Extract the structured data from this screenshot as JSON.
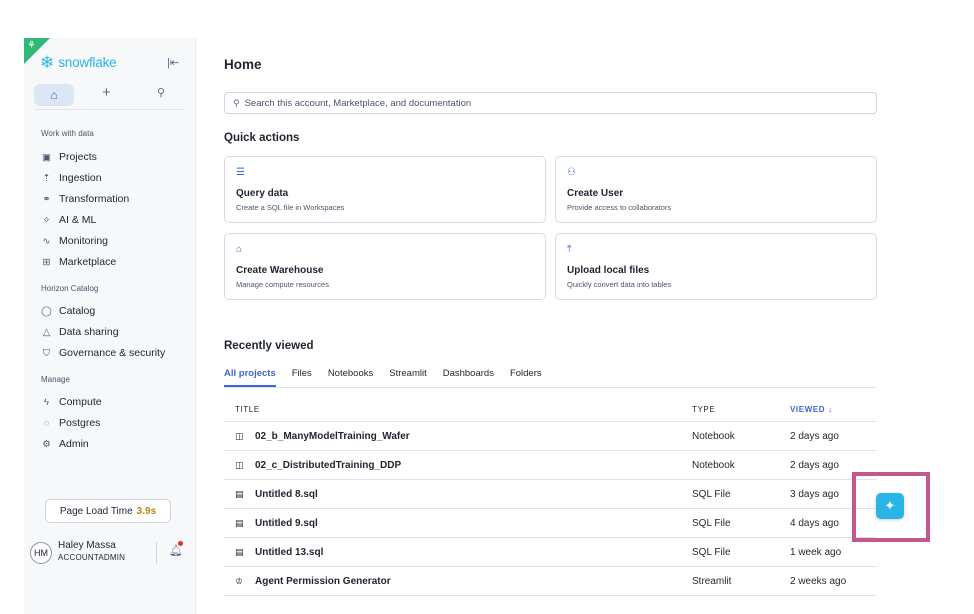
{
  "sidebar": {
    "brand": "snowflake",
    "sections": {
      "work_with_data": "Work with data",
      "horizon_catalog": "Horizon Catalog",
      "manage": "Manage"
    },
    "items": [
      {
        "label": "Projects",
        "icon": "projects-icon"
      },
      {
        "label": "Ingestion",
        "icon": "ingestion-icon"
      },
      {
        "label": "Transformation",
        "icon": "transformation-icon"
      },
      {
        "label": "AI & ML",
        "icon": "ai-ml-icon"
      },
      {
        "label": "Monitoring",
        "icon": "monitoring-icon"
      },
      {
        "label": "Marketplace",
        "icon": "marketplace-icon"
      },
      {
        "label": "Catalog",
        "icon": "catalog-icon"
      },
      {
        "label": "Data sharing",
        "icon": "data-sharing-icon"
      },
      {
        "label": "Governance & security",
        "icon": "shield-icon"
      },
      {
        "label": "Compute",
        "icon": "compute-icon"
      },
      {
        "label": "Postgres",
        "icon": "postgres-icon"
      },
      {
        "label": "Admin",
        "icon": "admin-icon"
      }
    ],
    "page_load_label": "Page Load Time",
    "page_load_value": "3.9s",
    "user": {
      "initials": "HM",
      "name": "Haley Massa",
      "role": "ACCOUNTADMIN"
    }
  },
  "main": {
    "title": "Home",
    "search_placeholder": "Search this account, Marketplace, and documentation",
    "quick_actions_title": "Quick actions",
    "quick_actions": [
      {
        "title": "Query data",
        "desc": "Create a SQL file in Workspaces",
        "icon": "query-icon"
      },
      {
        "title": "Create User",
        "desc": "Provide access to collaborators",
        "icon": "user-icon"
      },
      {
        "title": "Create Warehouse",
        "desc": "Manage compute resources",
        "icon": "warehouse-icon"
      },
      {
        "title": "Upload local files",
        "desc": "Quickly convert data into tables",
        "icon": "upload-icon"
      }
    ],
    "recently_viewed_title": "Recently viewed",
    "tabs": [
      "All projects",
      "Files",
      "Notebooks",
      "Streamlit",
      "Dashboards",
      "Folders"
    ],
    "table": {
      "headers": {
        "title": "TITLE",
        "type": "TYPE",
        "viewed": "VIEWED"
      },
      "rows": [
        {
          "title": "02_b_ManyModelTraining_Wafer",
          "type": "Notebook",
          "viewed": "2 days ago",
          "icon": "notebook-icon"
        },
        {
          "title": "02_c_DistributedTraining_DDP",
          "type": "Notebook",
          "viewed": "2 days ago",
          "icon": "notebook-icon"
        },
        {
          "title": "Untitled 8.sql",
          "type": "SQL File",
          "viewed": "3 days ago",
          "icon": "sql-file-icon"
        },
        {
          "title": "Untitled 9.sql",
          "type": "SQL File",
          "viewed": "4 days ago",
          "icon": "sql-file-icon"
        },
        {
          "title": "Untitled 13.sql",
          "type": "SQL File",
          "viewed": "1 week ago",
          "icon": "sql-file-icon"
        },
        {
          "title": "Agent Permission Generator",
          "type": "Streamlit",
          "viewed": "2 weeks ago",
          "icon": "streamlit-icon"
        }
      ]
    }
  },
  "colors": {
    "accent": "#3f65d4",
    "brand": "#29b5e8",
    "highlight": "#c2588f",
    "badge_green": "#32b877"
  }
}
